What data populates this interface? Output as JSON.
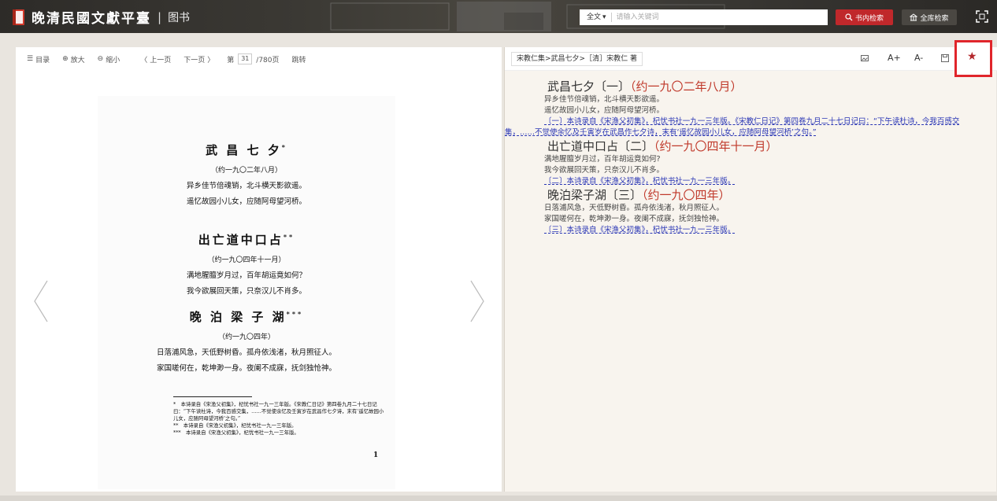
{
  "header": {
    "title": "晚清民國文獻平臺",
    "separator": "|",
    "subtitle": "图书",
    "search": {
      "type": "全文",
      "placeholder": "请输入关键词"
    },
    "btn_inbook": "书内检索",
    "btn_all": "全库检索"
  },
  "left_toolbar": {
    "toc": "目录",
    "zoom_in": "放大",
    "zoom_out": "缩小",
    "prev": "上一页",
    "next": "下一页",
    "page_prefix": "第",
    "page_value": "31",
    "page_total": "/780页",
    "goto": "跳转"
  },
  "scan": {
    "poems": [
      {
        "title": "武 昌 七 夕",
        "mark": "*",
        "date": "（约一九〇二年八月）",
        "lines": [
          "异乡佳节倍魂销，北斗横天影欲遥。",
          "遥忆故园小儿女，应随阿母望河桥。"
        ]
      },
      {
        "title": "出亡道中口占",
        "mark": "**",
        "date": "（约一九〇四年十一月）",
        "lines": [
          "满地腥膻岁月过，百年胡运竟如何？",
          "我今欲展回天策，只奈汉儿不肖多。"
        ]
      },
      {
        "title": "晚 泊 梁 子 湖",
        "mark": "***",
        "date": "（约一九〇四年）",
        "lines": [
          "日落浦风急，天低野树昏。孤舟依浅渚，秋月照征人。",
          "家国嗟何在，乾坤渺一身。夜阑不成寐，抚剑独怆神。"
        ]
      }
    ],
    "notes": [
      "*　本诗录自《宋渔父初集》，杞忧书社一九一三年版。《宋教仁日记》第四卷九月二十七日记曰：“下午读杜诗，今我百感交集，……不觉使余忆及壬寅岁在武昌作七夕诗，末有‘遥忆故园小儿女，应随阿母望河桥’之句。”",
      "**　本诗录自《宋渔父初集》，杞忧书社一九一三年版。",
      "***　本诗录自《宋渔父初集》，杞忧书社一九一三年版。"
    ],
    "page_number": "1"
  },
  "right_toolbar": {
    "breadcrumb": "宋教仁集>武昌七夕>［清］宋教仁 著",
    "font_up": "A+",
    "font_down": "A-"
  },
  "text": {
    "poems": [
      {
        "title": "武昌七夕〔一〕",
        "date": "（约一九〇二年八月）",
        "lines": [
          "异乡佳节倍魂销，北斗横天影欲遥。",
          "遥忆故园小儿女，应随阿母望河桥。"
        ],
        "note": "〔一〕本诗录自《宋渔父初集》，杞忧书社一九一三年版。《宋教仁日记》第四卷九月二十七日记曰：“下午读杜诗，今我百感交集，……不觉使余忆及壬寅岁在武昌作七夕诗，末有‘遥忆故园小儿女，应随阿母望河桥’之句。”"
      },
      {
        "title": "出亡道中口占〔二〕",
        "date": "（约一九〇四年十一月）",
        "lines": [
          "满地腥膻岁月过，百年胡运竟如何?",
          "我今欲展回天策，只奈汉儿不肖多。"
        ],
        "note": "〔二〕本诗录自《宋渔父初集》，杞忧书社一九一三年版。"
      },
      {
        "title": "晚泊梁子湖〔三〕",
        "date": "（约一九〇四年）",
        "lines": [
          "日落浦风急，天低野树昏。孤舟依浅渚，秋月照征人。",
          "家国嗟何在，乾坤渺一身。夜阑不成寐，抚剑独怆神。"
        ],
        "note": "〔三〕本诗录自《宋渔父初集》，杞忧书社一九一三年版。"
      }
    ]
  },
  "colors": {
    "accent_red": "#c0282b",
    "link_blue": "#2a36b5",
    "header_bg": "#3b3934",
    "date_red": "#c0392b"
  }
}
